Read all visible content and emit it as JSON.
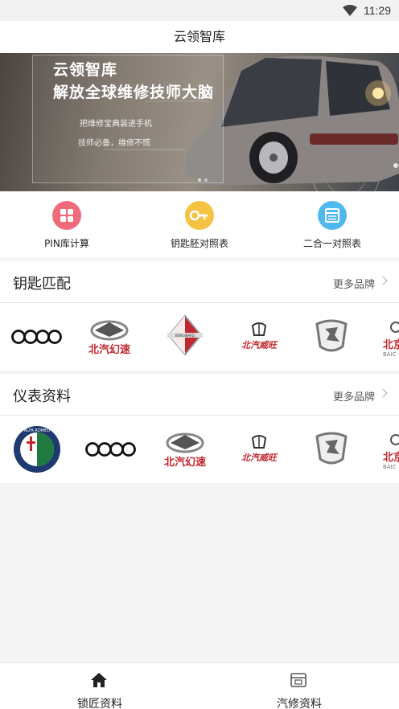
{
  "status_bar": {
    "time": "11:29"
  },
  "header": {
    "title": "云领智库"
  },
  "banner": {
    "title_line1": "云领智库",
    "title_line2": "解放全球维修技师大脑",
    "subtitle_line1": "把维修宝典装进手机",
    "subtitle_line2": "技师必备，维修不慌"
  },
  "shortcuts": [
    {
      "label": "PIN库计算",
      "color": "#ef6b7b",
      "icon": "grid-icon"
    },
    {
      "label": "钥匙胚对照表",
      "color": "#f5c244",
      "icon": "key-icon"
    },
    {
      "label": "二合一对照表",
      "color": "#4fb8ef",
      "icon": "table-icon"
    }
  ],
  "key_match": {
    "title": "钥匙匹配",
    "more": "更多品牌",
    "brands": [
      "audi-logo",
      "baic-huansu-logo",
      "borgward-logo",
      "baic-weiwang-logo",
      "baic-logo",
      "baic-partial-logo"
    ]
  },
  "dashboard_data": {
    "title": "仪表资料",
    "more": "更多品牌",
    "brands": [
      "alfa-romeo-logo",
      "audi-logo",
      "baic-huansu-logo",
      "baic-weiwang-logo",
      "baic-logo",
      "baic-partial-logo"
    ]
  },
  "logo_text": {
    "huansu": "北汽幻速",
    "weiwang": "北汽威旺",
    "borgward": "BORGWARD",
    "alfa": "ALFA ROMEO",
    "baic_partial": "北京",
    "baic_partial_en": "BAIC"
  },
  "bottom_nav": [
    {
      "label": "锁匠资料",
      "icon": "home-icon"
    },
    {
      "label": "汽修资料",
      "icon": "document-icon"
    }
  ],
  "colors": {
    "accent_red": "#c0282f",
    "divider": "#e8e8e8"
  }
}
